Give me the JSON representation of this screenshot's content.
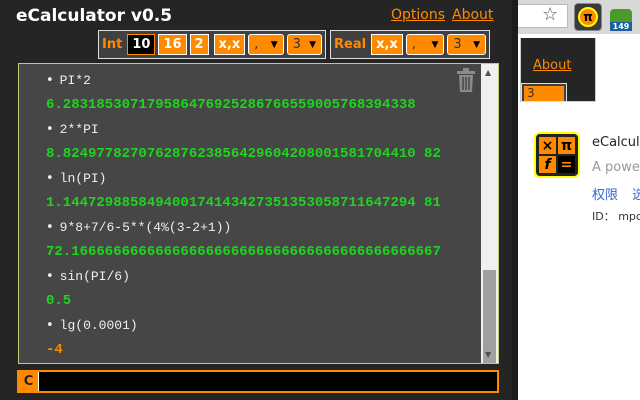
{
  "header": {
    "title": "eCalculator v0.5",
    "options": "Options",
    "about": "About"
  },
  "int_group": {
    "label": "Int",
    "bases": [
      "10",
      "16",
      "2"
    ],
    "selected_base": "10",
    "format": "x,x",
    "separator": ",",
    "precision": "3"
  },
  "real_group": {
    "label": "Real",
    "format": "x,x",
    "separator": ",",
    "precision": "3"
  },
  "history": [
    {
      "expr": "PI*2",
      "result": "6.283185307179586476925286766559005768394338",
      "type": "real"
    },
    {
      "expr": "2**PI",
      "result": "8.824977827076287623856429604208001581704410 82",
      "type": "real"
    },
    {
      "expr": "ln(PI)",
      "result": "1.144729885849400174143427351353058711647294 81",
      "type": "real"
    },
    {
      "expr": "9*8+7/6-5**(4%(3-2+1))",
      "result": "72.16666666666666666666666666666666666666666667",
      "type": "real"
    },
    {
      "expr": "sin(PI/6)",
      "result": "0.5",
      "type": "real"
    },
    {
      "expr": "lg(0.0001)",
      "result": "-4",
      "type": "int"
    }
  ],
  "input": {
    "clear_label": "C",
    "value": ""
  },
  "browser": {
    "badge": "149",
    "mini_about": "About",
    "mini_precision": "3",
    "ext_name": "eCalcula",
    "ext_desc": "A powerf",
    "ext_links": "权限 选",
    "ext_id": "ID： mpca",
    "icon_glyphs": [
      "×",
      "π",
      "f",
      "="
    ]
  }
}
